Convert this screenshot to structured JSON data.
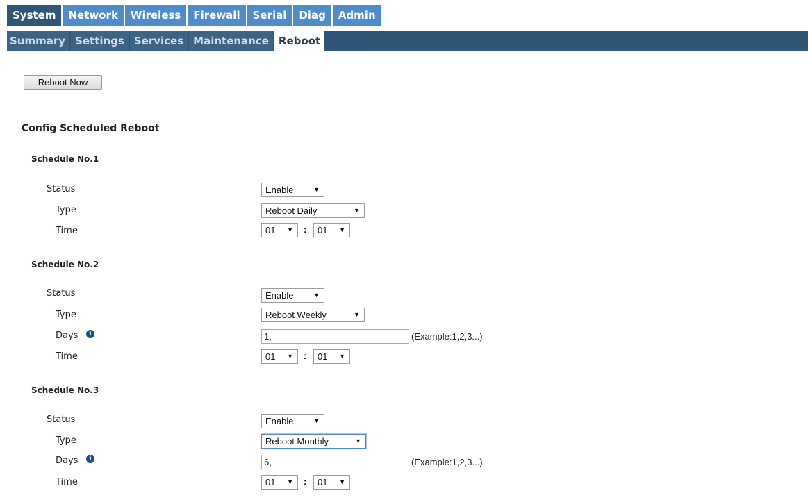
{
  "top_nav": {
    "tabs": [
      {
        "label": "System",
        "active": true
      },
      {
        "label": "Network",
        "active": false
      },
      {
        "label": "Wireless",
        "active": false
      },
      {
        "label": "Firewall",
        "active": false
      },
      {
        "label": "Serial",
        "active": false
      },
      {
        "label": "Diag",
        "active": false
      },
      {
        "label": "Admin",
        "active": false
      }
    ]
  },
  "sub_nav": {
    "tabs": [
      {
        "label": "Summary",
        "active": false
      },
      {
        "label": "Settings",
        "active": false
      },
      {
        "label": "Services",
        "active": false
      },
      {
        "label": "Maintenance",
        "active": false
      },
      {
        "label": "Reboot",
        "active": true
      }
    ]
  },
  "reboot_button": "Reboot Now",
  "section_title": "Config Scheduled Reboot",
  "labels": {
    "status": "Status",
    "type": "Type",
    "days": "Days",
    "time": "Time",
    "colon": ":",
    "example": "(Example:1,2,3...)"
  },
  "schedules": [
    {
      "title": "Schedule No.1",
      "status": "Enable",
      "type": "Reboot Daily",
      "hour": "01",
      "minute": "01"
    },
    {
      "title": "Schedule No.2",
      "status": "Enable",
      "type": "Reboot Weekly",
      "days": "1,",
      "hour": "01",
      "minute": "01"
    },
    {
      "title": "Schedule No.3",
      "status": "Enable",
      "type": "Reboot Monthly",
      "days": "6,",
      "hour": "01",
      "minute": "01"
    }
  ],
  "colors": {
    "tab_blue": "#4f8cc9",
    "tab_dark": "#2f5577",
    "info_icon": "#1b4f8e"
  },
  "icons": {
    "info": "info-icon",
    "dropdown": "chevron-down-icon"
  }
}
